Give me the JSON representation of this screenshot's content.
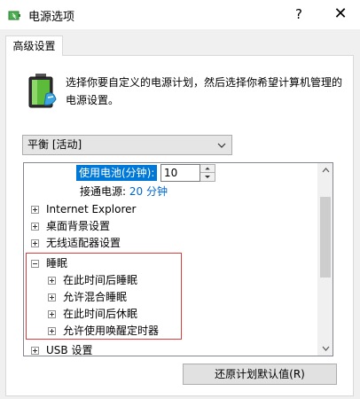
{
  "window": {
    "title": "电源选项",
    "help_glyph": "?",
    "close_glyph": "✕"
  },
  "tab": {
    "label": "高级设置"
  },
  "intro": {
    "text": "选择你要自定义的电源计划，然后选择你希望计算机管理的电源设置。"
  },
  "plan": {
    "selected": "平衡 [活动]"
  },
  "tree": {
    "battery_label": "使用电池(分钟):",
    "battery_value": "10",
    "ac_label": "接通电源:",
    "ac_value": "20 分钟",
    "items": [
      {
        "label": "Internet Explorer",
        "expanded": false
      },
      {
        "label": "桌面背景设置",
        "expanded": false
      },
      {
        "label": "无线适配器设置",
        "expanded": false
      },
      {
        "label": "睡眠",
        "expanded": true
      },
      {
        "label": "在此时间后睡眠",
        "expanded": false
      },
      {
        "label": "允许混合睡眠",
        "expanded": false
      },
      {
        "label": "在此时间后休眠",
        "expanded": false
      },
      {
        "label": "允许使用唤醒定时器",
        "expanded": false
      },
      {
        "label": "USB 设置",
        "expanded": false
      }
    ]
  },
  "buttons": {
    "restore": "还原计划默认值(R)"
  },
  "colors": {
    "accent": "#0078d7",
    "highlight_border": "#e03c3c",
    "link": "#0066cc"
  }
}
